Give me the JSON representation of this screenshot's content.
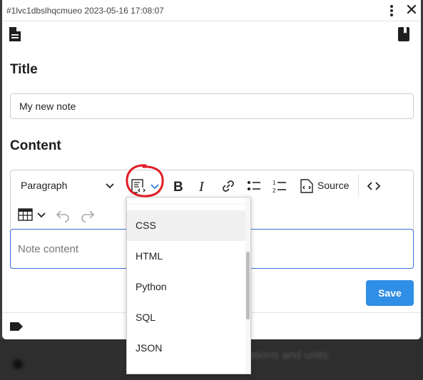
{
  "window": {
    "title": "#1lvc1dbslhqcmueo 2023-05-16 17:08:07",
    "close_glyph": "✕"
  },
  "icons": {
    "menu": "kebab-menu-icon",
    "note_type": "document-icon",
    "notebook": "notebook-icon",
    "tag": "tag-icon"
  },
  "title_section": {
    "heading": "Title",
    "value": "My new note"
  },
  "content_section": {
    "heading": "Content",
    "placeholder": "Note content"
  },
  "toolbar": {
    "paragraph_label": "Paragraph",
    "source_label": "Source",
    "buttons": [
      "code-block",
      "bold",
      "italic",
      "link",
      "bulleted-list",
      "numbered-list",
      "source",
      "code",
      "table",
      "undo",
      "redo"
    ]
  },
  "code_block_menu": {
    "items": [
      "CSS",
      "HTML",
      "Python",
      "SQL",
      "JSON"
    ],
    "selected": "CSS"
  },
  "save_label": "Save",
  "background_text": "ations and units",
  "colors": {
    "accent": "#2f8ee6",
    "focus_border": "#3b6fd8",
    "annotation": "#e01b24"
  }
}
